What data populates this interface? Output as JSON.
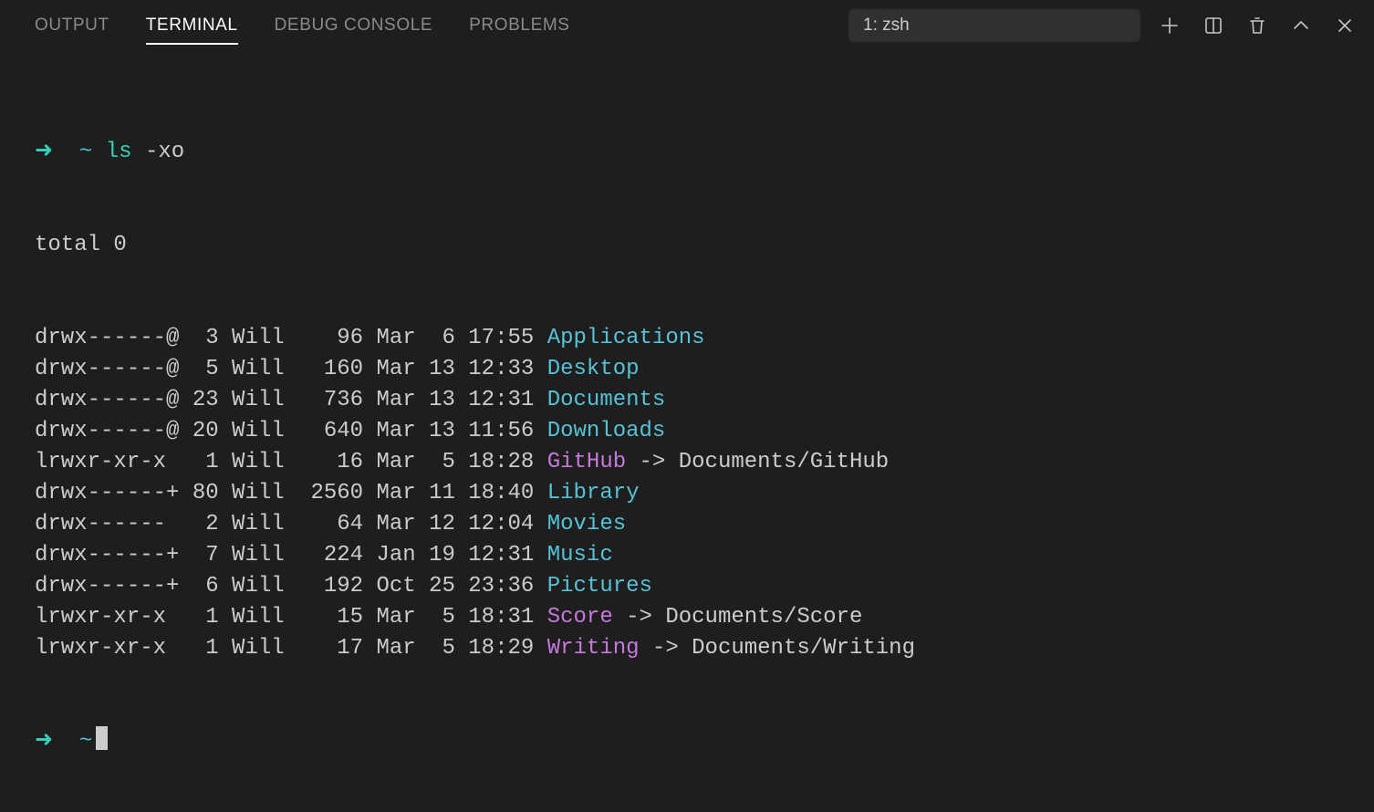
{
  "tabs": [
    {
      "label": "OUTPUT",
      "active": false
    },
    {
      "label": "TERMINAL",
      "active": true
    },
    {
      "label": "DEBUG CONSOLE",
      "active": false
    },
    {
      "label": "PROBLEMS",
      "active": false
    }
  ],
  "terminal_select": {
    "label": "1: zsh"
  },
  "prompt": {
    "arrow": "➜",
    "tilde": "~",
    "command": "ls",
    "args": "-xo"
  },
  "total_line": "total 0",
  "rows": [
    {
      "perm": "drwx------@",
      "links": " 3",
      "owner": "Will",
      "size": "  96",
      "date": "Mar  6 17:55",
      "name": "Applications",
      "type": "dir",
      "target": ""
    },
    {
      "perm": "drwx------@",
      "links": " 5",
      "owner": "Will",
      "size": " 160",
      "date": "Mar 13 12:33",
      "name": "Desktop",
      "type": "dir",
      "target": ""
    },
    {
      "perm": "drwx------@",
      "links": "23",
      "owner": "Will",
      "size": " 736",
      "date": "Mar 13 12:31",
      "name": "Documents",
      "type": "dir",
      "target": ""
    },
    {
      "perm": "drwx------@",
      "links": "20",
      "owner": "Will",
      "size": " 640",
      "date": "Mar 13 11:56",
      "name": "Downloads",
      "type": "dir",
      "target": ""
    },
    {
      "perm": "lrwxr-xr-x ",
      "links": " 1",
      "owner": "Will",
      "size": "  16",
      "date": "Mar  5 18:28",
      "name": "GitHub",
      "type": "link",
      "target": "Documents/GitHub"
    },
    {
      "perm": "drwx------+",
      "links": "80",
      "owner": "Will",
      "size": "2560",
      "date": "Mar 11 18:40",
      "name": "Library",
      "type": "dir",
      "target": ""
    },
    {
      "perm": "drwx------ ",
      "links": " 2",
      "owner": "Will",
      "size": "  64",
      "date": "Mar 12 12:04",
      "name": "Movies",
      "type": "dir",
      "target": ""
    },
    {
      "perm": "drwx------+",
      "links": " 7",
      "owner": "Will",
      "size": " 224",
      "date": "Jan 19 12:31",
      "name": "Music",
      "type": "dir",
      "target": ""
    },
    {
      "perm": "drwx------+",
      "links": " 6",
      "owner": "Will",
      "size": " 192",
      "date": "Oct 25 23:36",
      "name": "Pictures",
      "type": "dir",
      "target": ""
    },
    {
      "perm": "lrwxr-xr-x ",
      "links": " 1",
      "owner": "Will",
      "size": "  15",
      "date": "Mar  5 18:31",
      "name": "Score",
      "type": "link",
      "target": "Documents/Score"
    },
    {
      "perm": "lrwxr-xr-x ",
      "links": " 1",
      "owner": "Will",
      "size": "  17",
      "date": "Mar  5 18:29",
      "name": "Writing",
      "type": "link",
      "target": "Documents/Writing"
    }
  ]
}
